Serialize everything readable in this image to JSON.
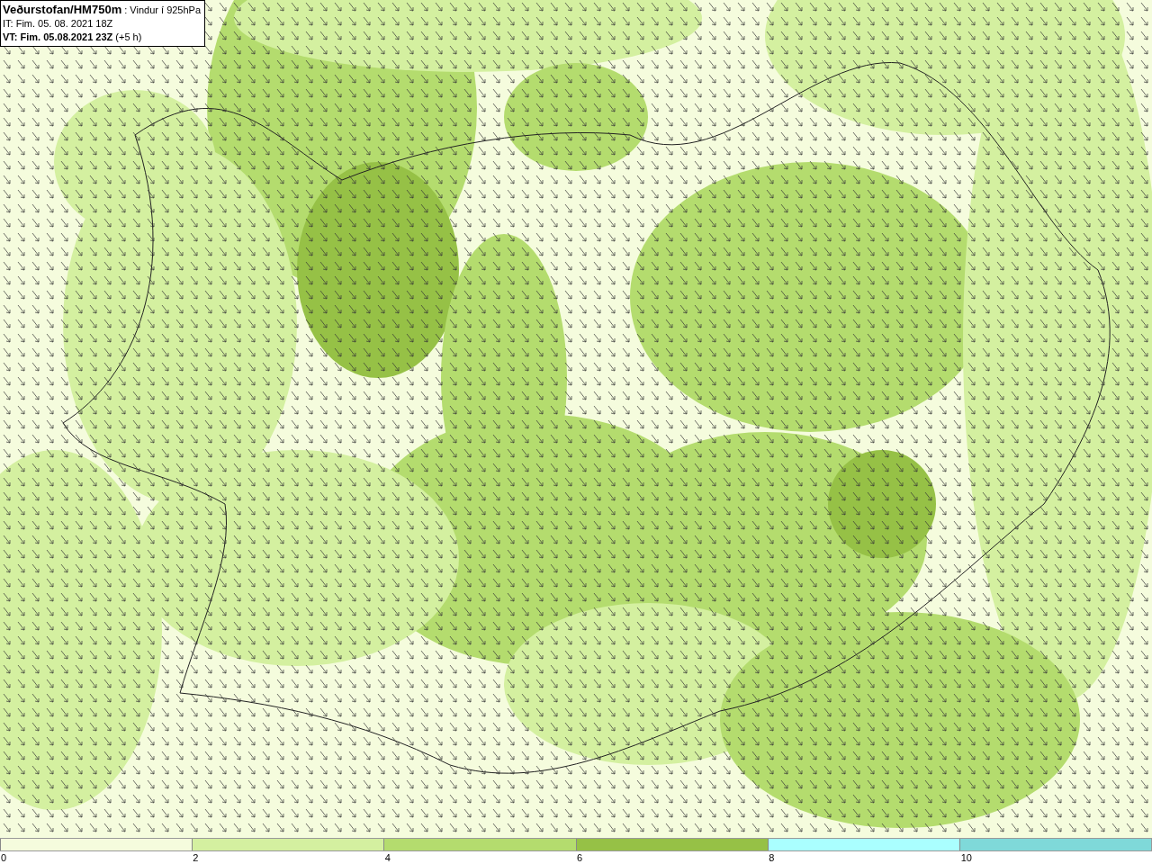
{
  "title_box": {
    "lines": [
      "**Veðurstofan/HM750m** : Vindur í 925hPa",
      "IT: Fim. 05. 08. 2021 18Z",
      "**VT: Fim. 05.08.2021 23Z** (+5 h)"
    ]
  },
  "legend": [
    {
      "label": "0",
      "color": "#f5fcdd"
    },
    {
      "label": "2",
      "color": "#d4f0a0"
    },
    {
      "label": "4",
      "color": "#b4dc6e"
    },
    {
      "label": "6",
      "color": "#96c146"
    },
    {
      "label": "8",
      "color": "#aaffff"
    },
    {
      "label": "10",
      "color": "#7fd9d9"
    }
  ]
}
